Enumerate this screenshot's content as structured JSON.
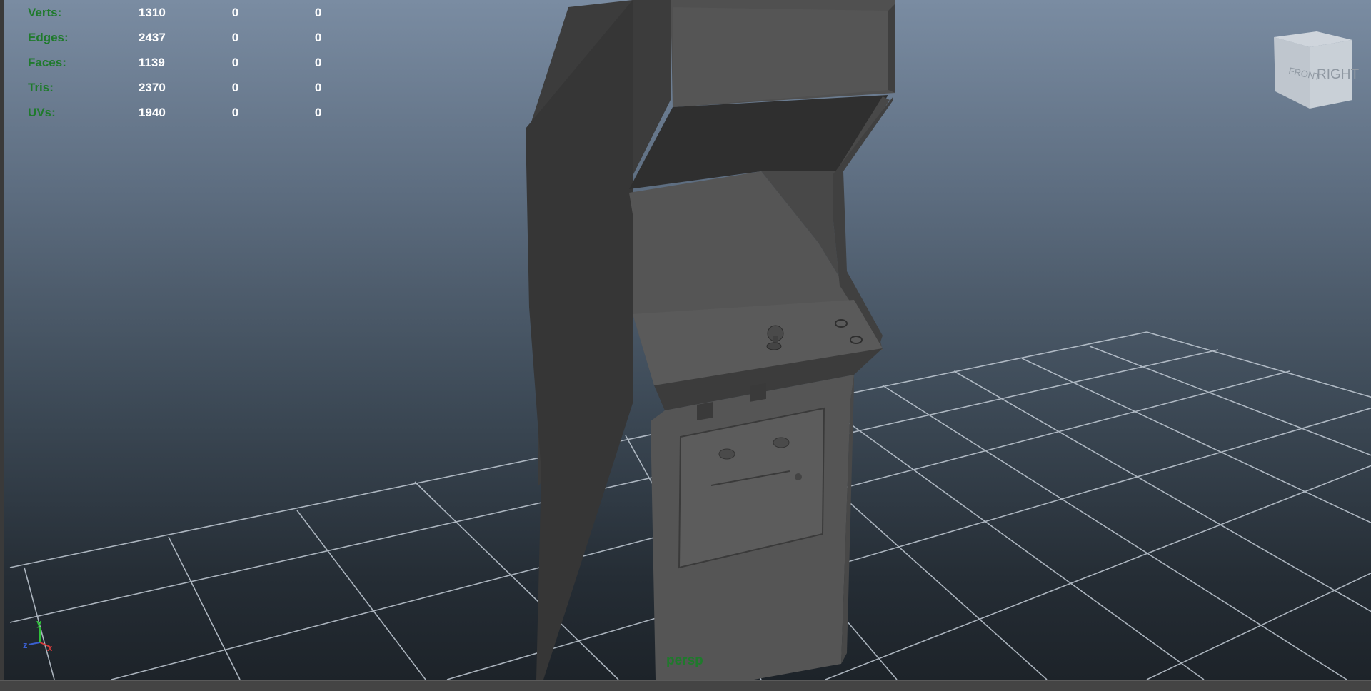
{
  "hud": {
    "rows": [
      {
        "label": "Verts:",
        "values": [
          "1310",
          "0",
          "0"
        ]
      },
      {
        "label": "Edges:",
        "values": [
          "2437",
          "0",
          "0"
        ]
      },
      {
        "label": "Faces:",
        "values": [
          "1139",
          "0",
          "0"
        ]
      },
      {
        "label": "Tris:",
        "values": [
          "2370",
          "0",
          "0"
        ]
      },
      {
        "label": "UVs:",
        "values": [
          "1940",
          "0",
          "0"
        ]
      }
    ]
  },
  "viewport": {
    "camera": "persp",
    "view_cube": {
      "front_label": "FRONT",
      "right_label": "RIGHT"
    },
    "axis": {
      "y": "y",
      "x": "x",
      "z": "z"
    }
  },
  "colors": {
    "hud_label": "#1f7a2c",
    "hud_value": "#ffffff",
    "grid": "#b8c2cc",
    "model": "#4a4a4a"
  }
}
